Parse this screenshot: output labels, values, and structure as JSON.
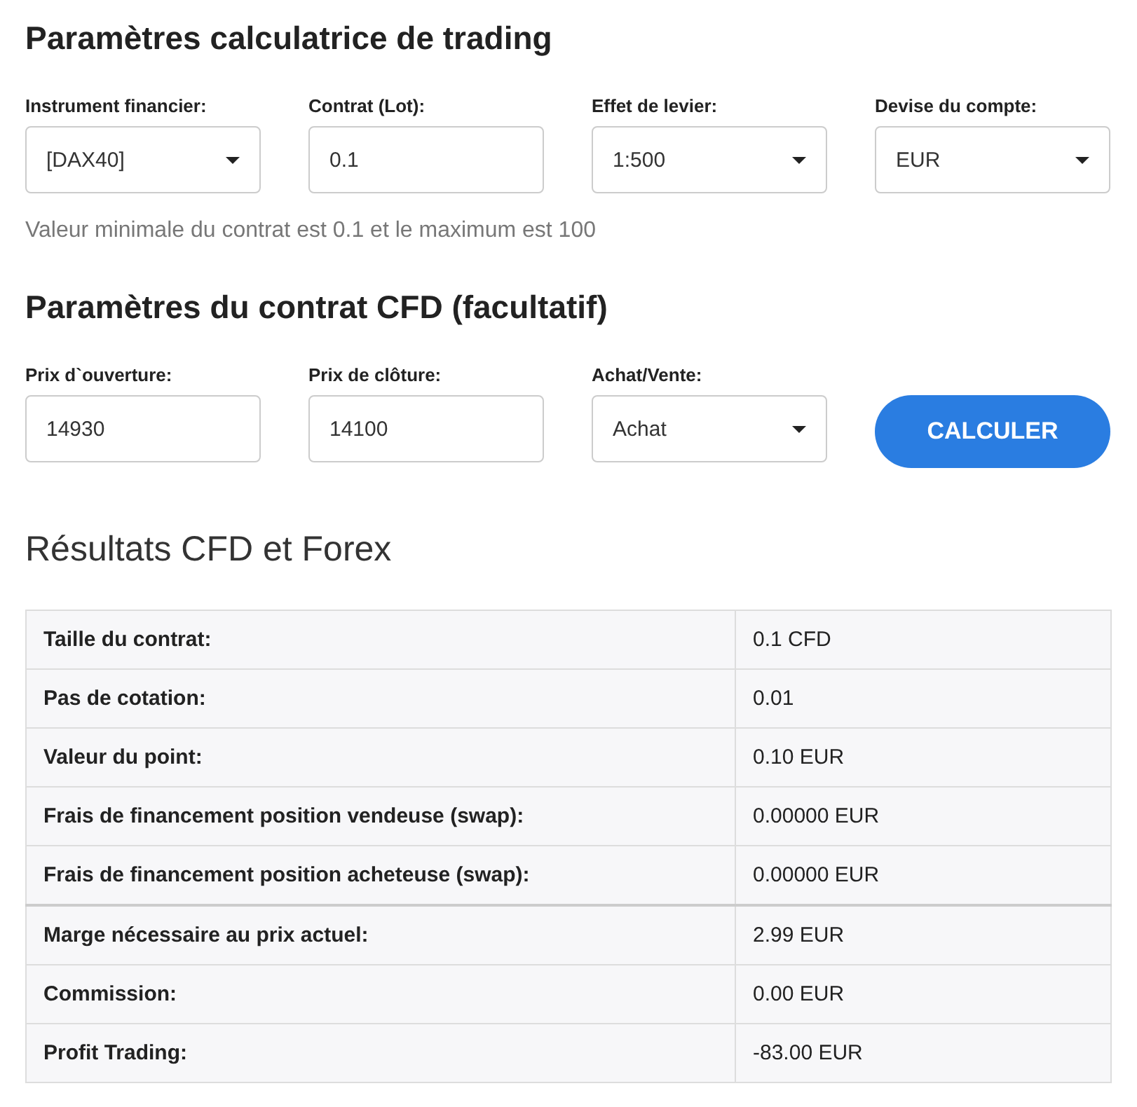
{
  "settings": {
    "title": "Paramètres calculatrice de trading",
    "fields": [
      {
        "label": "Instrument financier:",
        "kind": "select",
        "value": "[DAX40]"
      },
      {
        "label": "Contrat (Lot):",
        "kind": "input",
        "value": "0.1"
      },
      {
        "label": "Effet de levier:",
        "kind": "select",
        "value": "1:500"
      },
      {
        "label": "Devise du compte:",
        "kind": "select",
        "value": "EUR"
      }
    ],
    "hint": "Valeur minimale du contrat est 0.1 et le maximum est 100"
  },
  "contract": {
    "title": "Paramètres du contrat CFD (facultatif)",
    "fields": [
      {
        "label": "Prix d`ouverture:",
        "kind": "input",
        "value": "14930"
      },
      {
        "label": "Prix de clôture:",
        "kind": "input",
        "value": "14100"
      },
      {
        "label": "Achat/Vente:",
        "kind": "select",
        "value": "Achat"
      }
    ],
    "button": "CALCULER"
  },
  "results": {
    "title": "Résultats CFD et Forex",
    "rows": [
      {
        "label": "Taille du contrat:",
        "value": "0.1 CFD"
      },
      {
        "label": "Pas de cotation:",
        "value": "0.01"
      },
      {
        "label": "Valeur du point:",
        "value": "0.10 EUR"
      },
      {
        "label": "Frais de financement position vendeuse (swap):",
        "value": "0.00000 EUR"
      },
      {
        "label": "Frais de financement position acheteuse (swap):",
        "value": "0.00000 EUR"
      },
      {
        "label": "Marge nécessaire au prix actuel:",
        "value": "2.99 EUR"
      },
      {
        "label": "Commission:",
        "value": "0.00 EUR"
      },
      {
        "label": "Profit Trading:",
        "value": "-83.00 EUR"
      }
    ]
  }
}
